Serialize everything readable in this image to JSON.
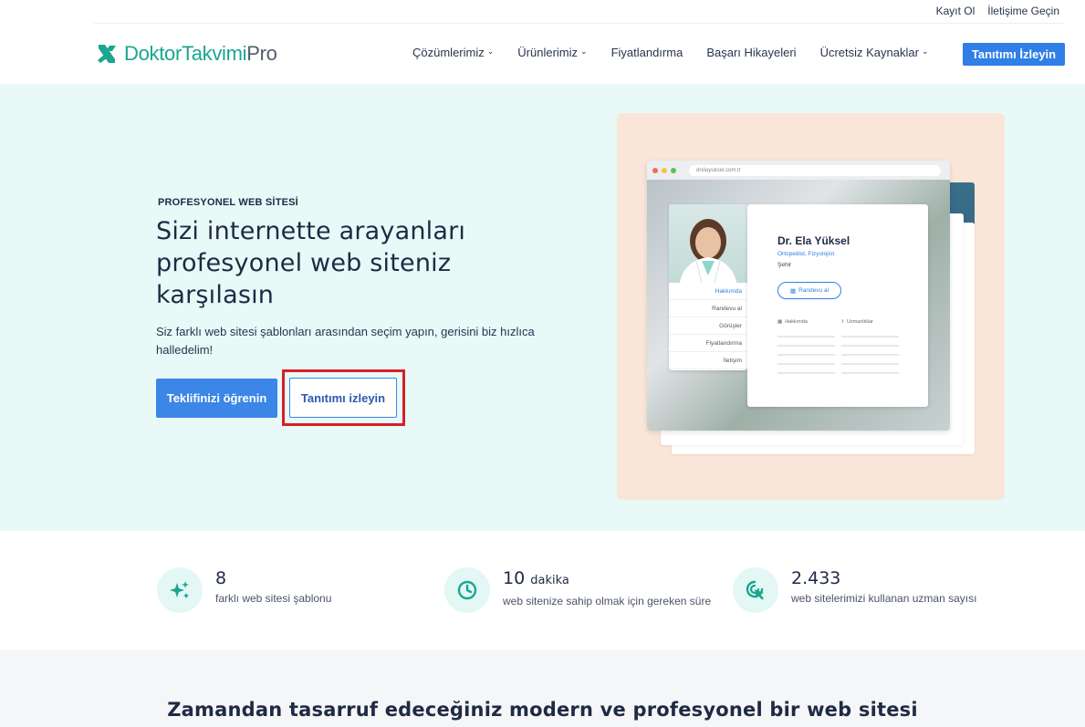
{
  "topbar": {
    "signup": "Kayıt Ol",
    "contact": "İletişime Geçin"
  },
  "brand": {
    "name": "DoktorTakvimi",
    "suffix": "Pro",
    "color": "#1aa68f"
  },
  "nav": {
    "items": [
      {
        "label": "Çözümlerimiz",
        "dropdown": true
      },
      {
        "label": "Ürünlerimiz",
        "dropdown": true
      },
      {
        "label": "Fiyatlandırma",
        "dropdown": false
      },
      {
        "label": "Başarı Hikayeleri",
        "dropdown": false
      },
      {
        "label": "Ücretsiz Kaynaklar",
        "dropdown": true
      }
    ],
    "cta": "Tanıtımı İzleyin"
  },
  "hero": {
    "eyebrow": "PROFESYONEL WEB SİTESİ",
    "headline": "Sizi internette arayanları profesyonel web siteniz karşılasın",
    "subtitle": "Siz farklı web sitesi şablonları arasından seçim yapın, gerisini biz hızlıca halledelim!",
    "primary_button": "Teklifinizi öğrenin",
    "secondary_button": "Tanıtımı izleyin"
  },
  "mockup": {
    "url": "drelayuksel.com.tr",
    "doctor_name": "Dr. Ela Yüksel",
    "specialty": "Ortopedist, Fizyolojist",
    "city": "Şehir",
    "appointment_button": "Randevu al",
    "menu": [
      "Hakkımda",
      "Randevu al",
      "Görüşler",
      "Fiyatlandırma",
      "İletişim"
    ],
    "tabs": [
      "Hakkımda",
      "Uzmanlıklar"
    ]
  },
  "stats": [
    {
      "icon": "sparkle-icon",
      "value": "8",
      "unit": "",
      "label": "farklı web sitesi şablonu"
    },
    {
      "icon": "clock-icon",
      "value": "10",
      "unit": "dakika",
      "label": "web sitenize sahip olmak için gereken süre"
    },
    {
      "icon": "cursor-click-icon",
      "value": "2.433",
      "unit": "",
      "label": "web sitelerimizi kullanan uzman sayısı"
    }
  ],
  "section": {
    "title": "Zamandan tasarruf edeceğiniz modern ve profesyonel bir web sitesi"
  },
  "colors": {
    "accent": "#2f7fe6",
    "hero_bg": "#e8f9f8",
    "highlight": "#d81f26"
  }
}
